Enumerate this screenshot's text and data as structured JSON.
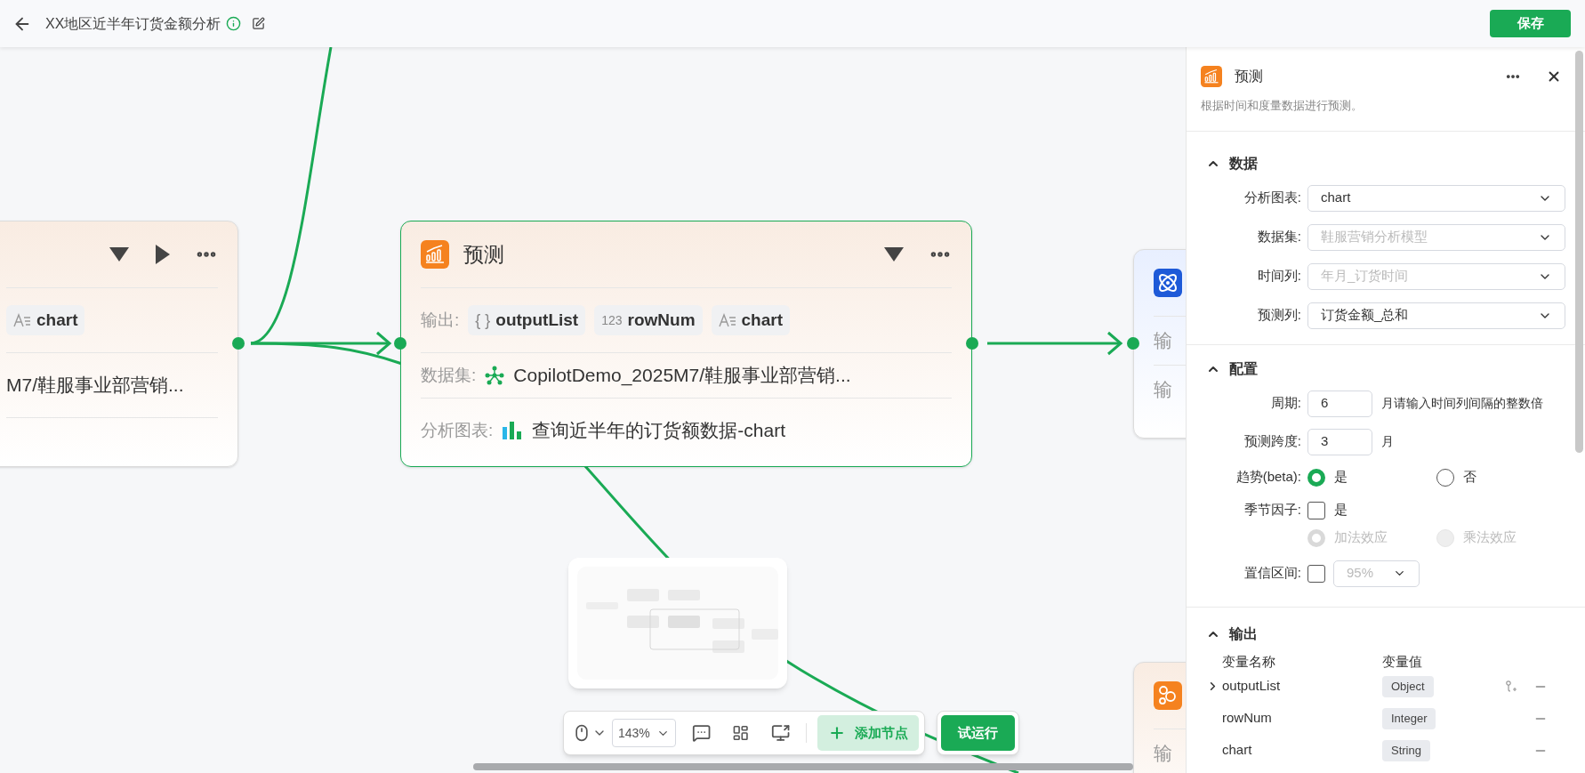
{
  "top_bar": {
    "title": "XX地区近半年订货金额分析",
    "save_label": "保存"
  },
  "canvas": {
    "nodes": [
      {
        "kind": "upstream",
        "selected": false,
        "runnable": true,
        "rows": [
          {
            "kind": "outputs",
            "chips": [
              {
                "kind": "string",
                "label": "chart"
              }
            ]
          },
          {
            "kind": "text",
            "value": "M7/鞋服事业部营销..."
          }
        ]
      },
      {
        "kind": "forecast",
        "selected": true,
        "runnable": false,
        "title": "预测",
        "rows": [
          {
            "kind": "outputs",
            "label": "输出:",
            "chips": [
              {
                "kind": "object",
                "mark": "{ }",
                "label": "outputList"
              },
              {
                "kind": "integer",
                "mark": "123",
                "label": "rowNum"
              },
              {
                "kind": "string",
                "label": "chart"
              }
            ]
          },
          {
            "kind": "dataset",
            "label": "数据集:",
            "value": "CopilotDemo_2025M7/鞋服事业部营销..."
          },
          {
            "kind": "chart",
            "label": "分析图表:",
            "value": "查询近半年的订货额数据-chart"
          }
        ]
      },
      {
        "kind": "science",
        "selected": false,
        "rows": [
          {
            "kind": "label",
            "label": "输"
          },
          {
            "kind": "label",
            "label": "输"
          }
        ]
      },
      {
        "kind": "cluster",
        "selected": false,
        "rows": [
          {
            "kind": "label",
            "label": "输"
          }
        ]
      }
    ]
  },
  "toolbar": {
    "zoom": "143%",
    "add_label": "添加节点",
    "run_label": "试运行"
  },
  "panel": {
    "title": "预测",
    "description": "根据时间和度量数据进行预测。",
    "data_section": {
      "title": "数据",
      "expanded": true,
      "fields": [
        {
          "label": "分析图表:",
          "value": "chart",
          "disabled": false
        },
        {
          "label": "数据集:",
          "value": "鞋服营销分析模型",
          "disabled": true
        },
        {
          "label": "时间列:",
          "value": "年月_订货时间",
          "disabled": true
        },
        {
          "label": "预测列:",
          "value": "订货金额_总和",
          "disabled": false
        }
      ]
    },
    "config_section": {
      "title": "配置",
      "expanded": true,
      "rows": [
        {
          "kind": "number",
          "label": "周期:",
          "value": "6",
          "unit": "月",
          "hint": "请输入时间列间隔的整数倍"
        },
        {
          "kind": "number",
          "label": "预测跨度:",
          "value": "3",
          "unit": "月"
        },
        {
          "kind": "radio",
          "label": "趋势(beta):",
          "options": [
            {
              "label": "是",
              "selected": true,
              "disabled": false
            },
            {
              "label": "否",
              "selected": false,
              "disabled": false
            }
          ]
        },
        {
          "kind": "checkbox",
          "label": "季节因子:",
          "checked": false,
          "text": "是"
        },
        {
          "kind": "radio",
          "options": [
            {
              "label": "加法效应",
              "selected": true,
              "disabled": true
            },
            {
              "label": "乘法效应",
              "selected": false,
              "disabled": true
            }
          ]
        },
        {
          "kind": "checkbox_select",
          "label": "置信区间:",
          "checked": false,
          "value": "95%",
          "disabled": true
        }
      ]
    },
    "output_section": {
      "title": "输出",
      "expanded": true,
      "columns": [
        "变量名称",
        "变量值"
      ],
      "rows": [
        {
          "name": "outputList",
          "type": "Object",
          "expandable": true,
          "linkable": true
        },
        {
          "name": "rowNum",
          "type": "Integer",
          "expandable": false,
          "linkable": false
        },
        {
          "name": "chart",
          "type": "String",
          "expandable": false,
          "linkable": false
        }
      ]
    }
  }
}
